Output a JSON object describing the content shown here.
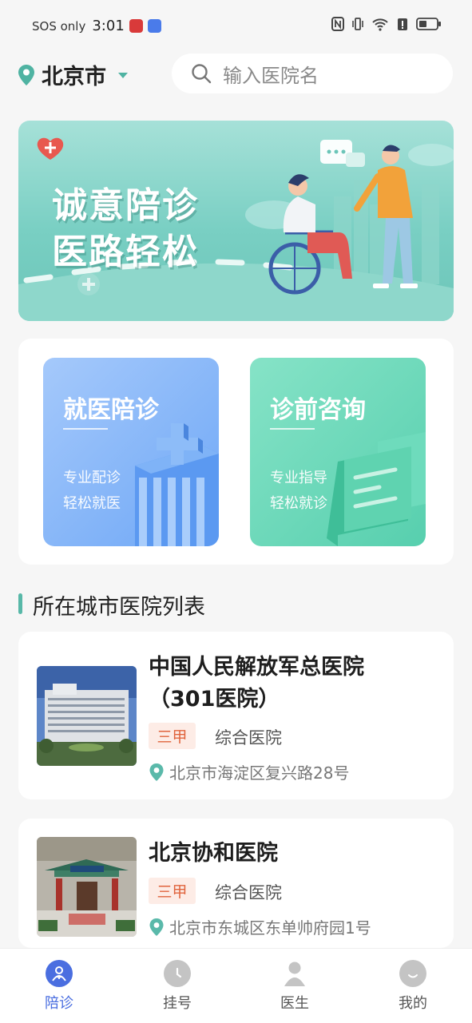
{
  "status_bar": {
    "carrier": "SOS only",
    "time": "3:01"
  },
  "header": {
    "city": "北京市",
    "search_placeholder": "输入医院名"
  },
  "banner": {
    "line1": "诚意陪诊",
    "line2": "医路轻松"
  },
  "services": [
    {
      "title": "就医陪诊",
      "sub1": "专业配诊",
      "sub2": "轻松就医",
      "color": "#6ea7f6"
    },
    {
      "title": "诊前咨询",
      "sub1": "专业指导",
      "sub2": "轻松就诊",
      "color": "#57cfae"
    }
  ],
  "section": {
    "title": "所在城市医院列表"
  },
  "hospitals": [
    {
      "name_line1": "中国人民解放军总医院",
      "name_line2": "（301医院）",
      "grade": "三甲",
      "type": "综合医院",
      "address": "北京市海淀区复兴路28号"
    },
    {
      "name_line1": "北京协和医院",
      "grade": "三甲",
      "type": "综合医院",
      "address": "北京市东城区东单帅府园1号"
    }
  ],
  "tabbar": {
    "items": [
      {
        "label": "陪诊",
        "icon": "companion-icon",
        "active": true
      },
      {
        "label": "挂号",
        "icon": "clock-icon",
        "active": false
      },
      {
        "label": "医生",
        "icon": "doctor-icon",
        "active": false
      },
      {
        "label": "我的",
        "icon": "profile-icon",
        "active": false
      }
    ]
  },
  "colors": {
    "accent": "#58b8a8",
    "tab_active": "#4a6ee0",
    "grade_text": "#e0643d",
    "grade_bg": "#fdece6"
  }
}
